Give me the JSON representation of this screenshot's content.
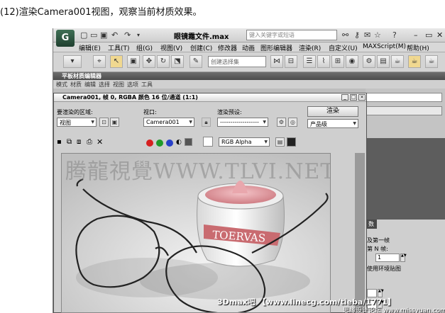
{
  "caption": "(12)渲染Camera001视图，观察当前材质效果。",
  "app": {
    "logo": "G",
    "document_title": "眼镜霜文件.max",
    "search_placeholder": "键入关键字或短语",
    "menu": [
      "编辑(E)",
      "工具(T)",
      "组(G)",
      "视图(V)",
      "创建(C)",
      "修改器",
      "动画",
      "图形编辑器",
      "渲染(R)",
      "自定义(U)",
      "MAXScript(M)",
      "帮助(H)"
    ],
    "selection_set_placeholder": "创建选择集"
  },
  "slate": {
    "title": "平板材质编辑器",
    "menu": [
      "模式",
      "材质",
      "编辑",
      "选择",
      "视图",
      "选项",
      "工具"
    ]
  },
  "render_window": {
    "title": "Camera001, 帧 0, RGBA 颜色 16 位/通道 (1:1)",
    "area_label": "要渲染的区域:",
    "area_value": "视图",
    "viewport_label": "视口:",
    "viewport_value": "Camera001",
    "preset_label": "渲染预设:",
    "preset_value": "-------------------",
    "render_button": "渲染",
    "quality_value": "产品级",
    "channel_value": "RGB Alpha"
  },
  "right_panel": {
    "tab_label": "数",
    "option1": "及第一帧",
    "option2": "第 N 帧:",
    "spinner_value": "1",
    "option3": "使用环境贴图"
  },
  "watermark": "腾龍視覺WWW.TLVI.NET",
  "jar_label": "TOERVAS",
  "footer_watermark": "3Dmax吧 【www.linecg.com/tieba/1771】",
  "footer_watermark2": "思缘设计论坛 www.missyuan.com",
  "colors": {
    "red_channel": "#d62020",
    "green_channel": "#1f9a2a",
    "blue_channel": "#2840c8"
  }
}
